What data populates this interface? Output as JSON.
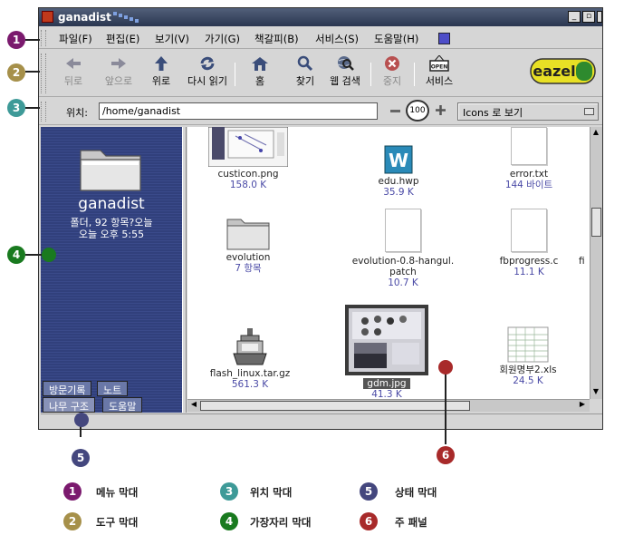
{
  "window": {
    "title": "ganadist"
  },
  "menu": [
    "파일(F)",
    "편집(E)",
    "보기(V)",
    "가기(G)",
    "책갈피(B)",
    "서비스(S)",
    "도움말(H)"
  ],
  "toolbar": [
    {
      "label": "뒤로",
      "icon": "back-arrow-icon",
      "enabled": false
    },
    {
      "label": "앞으로",
      "icon": "forward-arrow-icon",
      "enabled": false
    },
    {
      "label": "위로",
      "icon": "up-arrow-icon",
      "enabled": true
    },
    {
      "label": "다시 읽기",
      "icon": "reload-icon",
      "enabled": true
    },
    {
      "label": "홈",
      "icon": "home-icon",
      "enabled": true
    },
    {
      "label": "찾기",
      "icon": "magnifier-icon",
      "enabled": true
    },
    {
      "label": "웹 검색",
      "icon": "globe-search-icon",
      "enabled": true
    },
    {
      "label": "중지",
      "icon": "stop-icon",
      "enabled": false
    },
    {
      "label": "서비스",
      "icon": "open-sign-icon",
      "enabled": true
    }
  ],
  "eazel_logo": "eazel",
  "open_sign": "OPEN",
  "location": {
    "label": "위치:",
    "value": "/home/ganadist",
    "zoom": "100",
    "view_mode": "Icons 로 보기"
  },
  "sidebar": {
    "title": "ganadist",
    "info_line1": "폴더, 92 항목?오늘",
    "info_line2": "오늘 오후 5:55",
    "tabs": [
      "방문기록",
      "노트",
      "나무 구조",
      "도움말"
    ]
  },
  "files": [
    {
      "name": "custicon.png",
      "size": "158.0 K",
      "kind": "image"
    },
    {
      "name": "edu.hwp",
      "size": "35.9 K",
      "kind": "hwp"
    },
    {
      "name": "error.txt",
      "size": "144 바이트",
      "kind": "doc"
    },
    {
      "name": "evolution",
      "size": "7 항목",
      "kind": "folder"
    },
    {
      "name": "evolution-0.8-hangul.",
      "name2": "patch",
      "size": "10.7 K",
      "kind": "doc"
    },
    {
      "name": "fbprogress.c",
      "size": "11.1 K",
      "kind": "doc"
    },
    {
      "name": "fi",
      "size": "",
      "kind": "partial"
    },
    {
      "name": "flash_linux.tar.gz",
      "size": "561.3 K",
      "kind": "archive"
    },
    {
      "name": "gdm.jpg",
      "size": "41.3 K",
      "kind": "image-selected"
    },
    {
      "name": "회원명부2.xls",
      "size": "24.5 K",
      "kind": "spreadsheet"
    }
  ],
  "hwp_letter": "W",
  "callouts": [
    {
      "num": "1",
      "label": "메뉴 막대",
      "color": "#7b1a6e"
    },
    {
      "num": "2",
      "label": "도구 막대",
      "color": "#a6904a"
    },
    {
      "num": "3",
      "label": "위치 막대",
      "color": "#3e9a98"
    },
    {
      "num": "4",
      "label": "가장자리 막대",
      "color": "#197a1f"
    },
    {
      "num": "5",
      "label": "상태 막대",
      "color": "#44477e"
    },
    {
      "num": "6",
      "label": "주 패널",
      "color": "#a82a2a"
    }
  ]
}
